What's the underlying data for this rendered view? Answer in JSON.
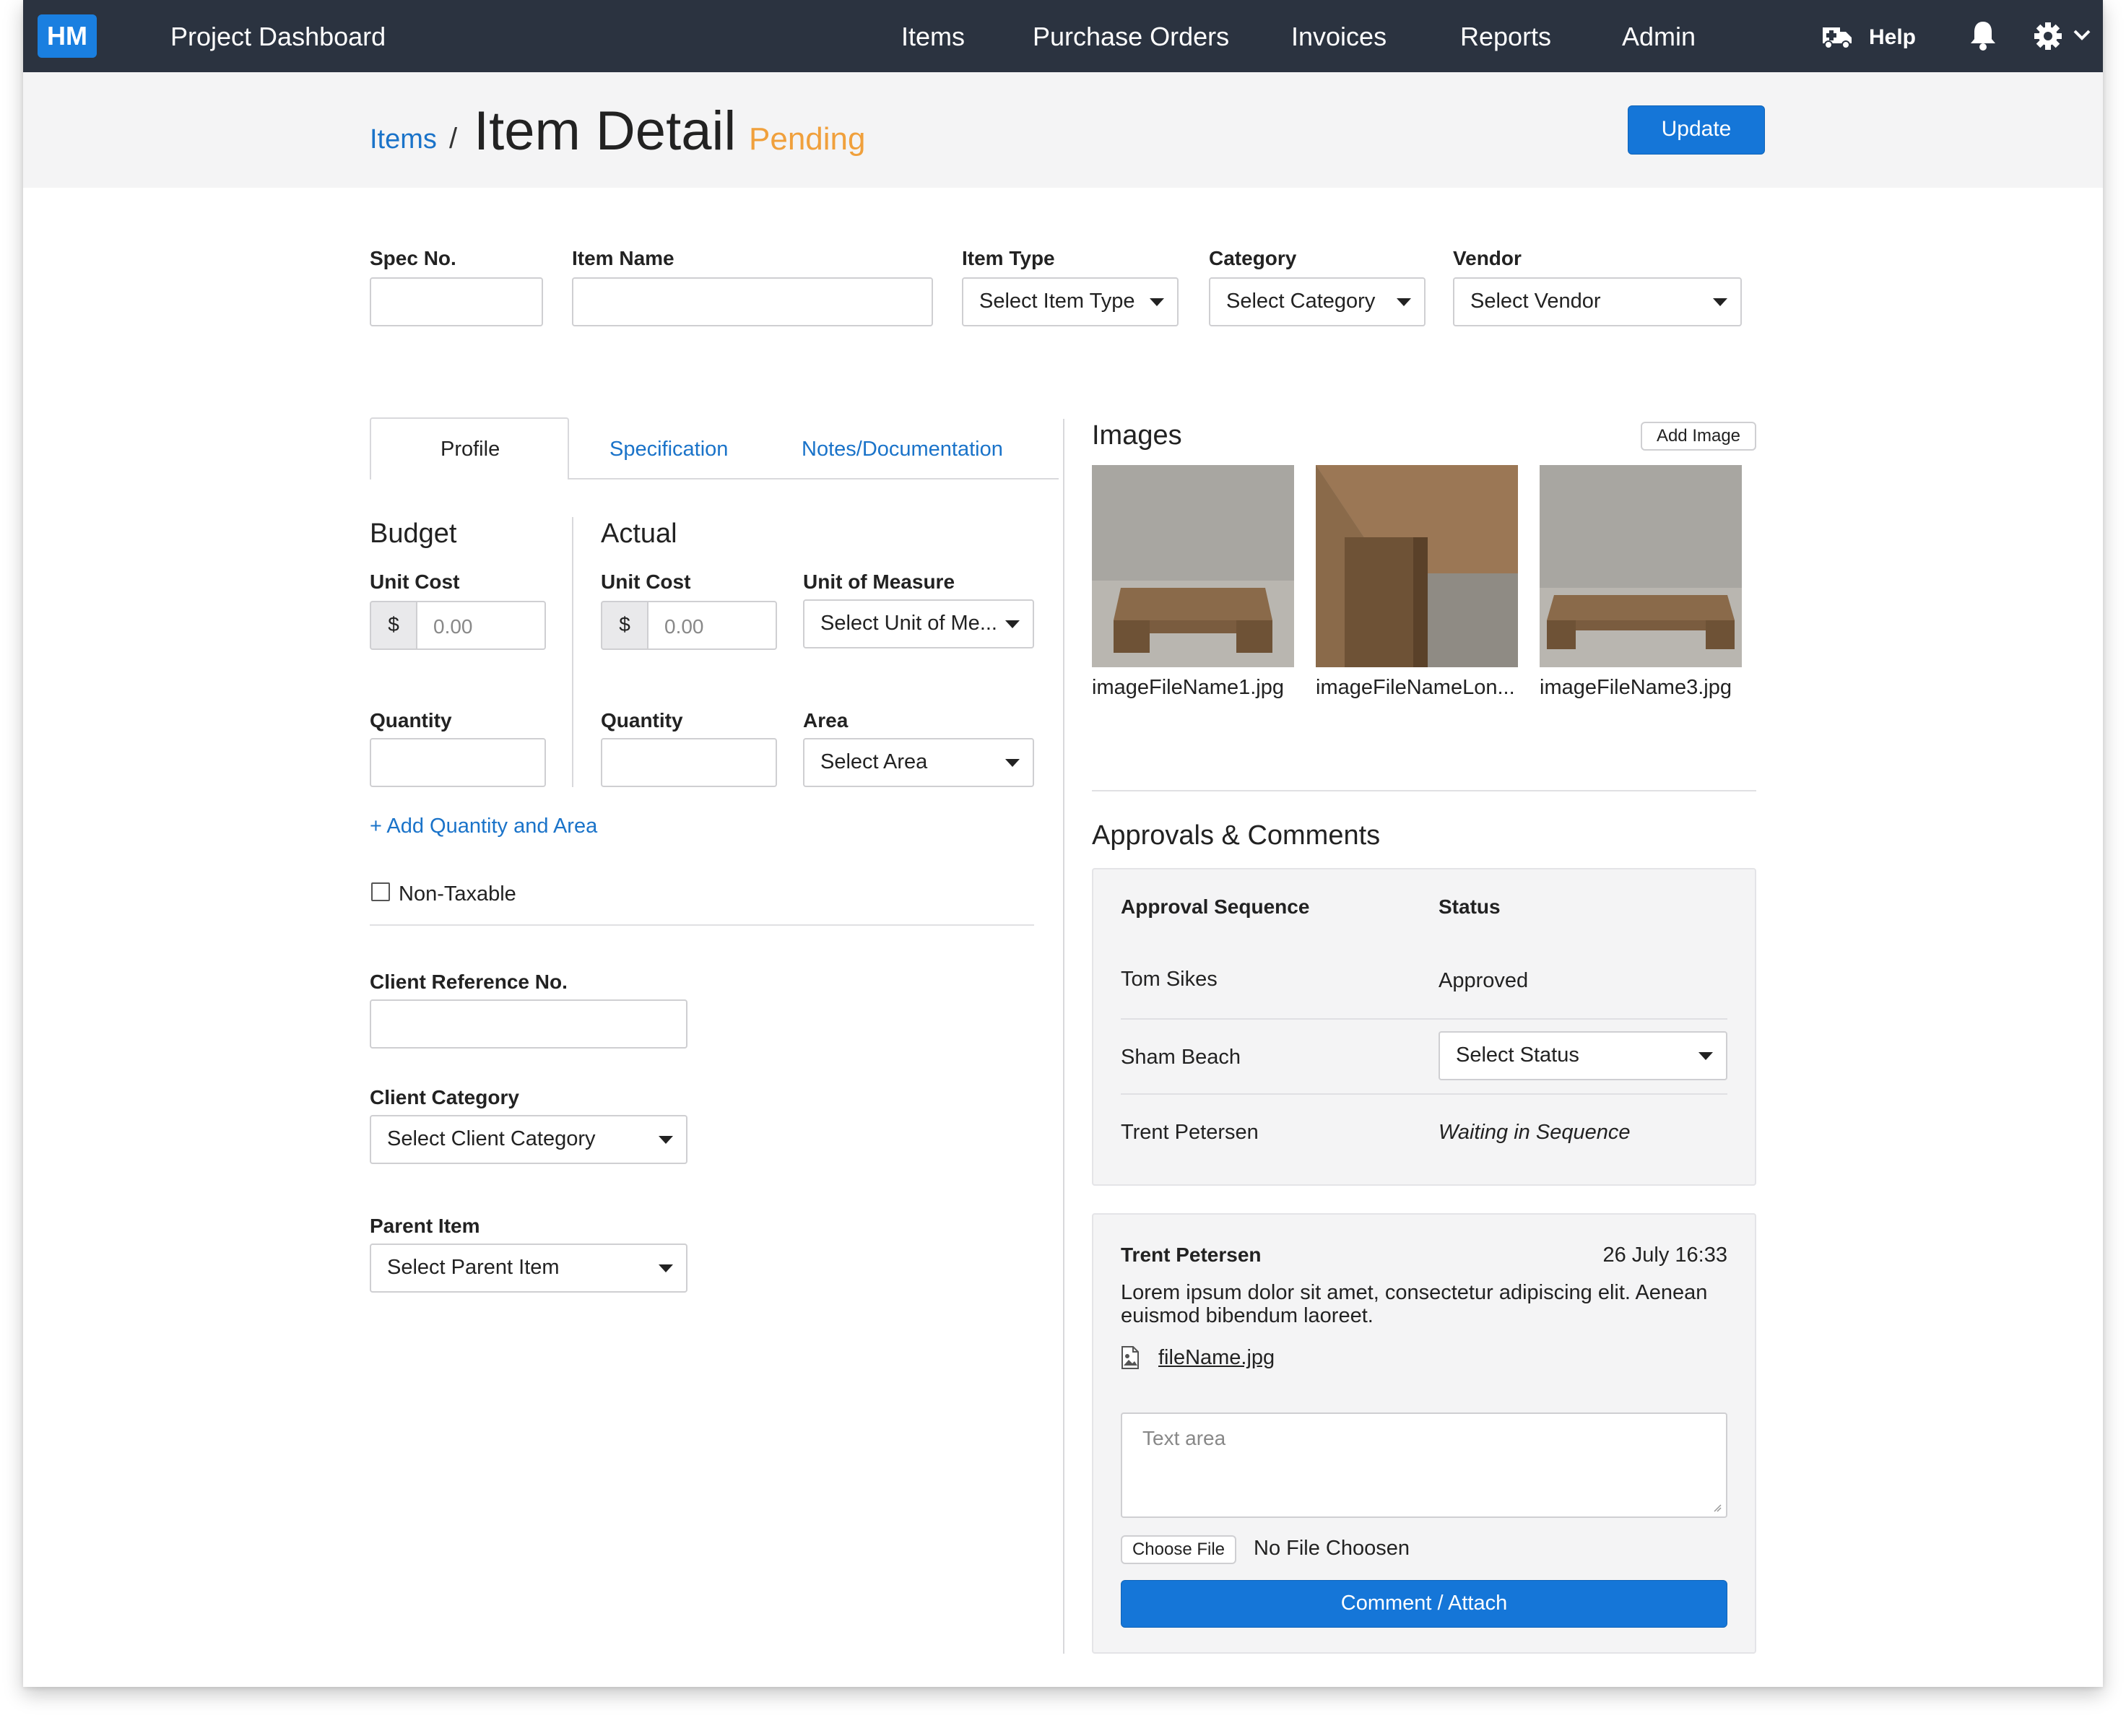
{
  "nav": {
    "logo": "HM",
    "app_title": "Project Dashboard",
    "links": [
      "Items",
      "Purchase Orders",
      "Invoices",
      "Reports",
      "Admin"
    ],
    "help": "Help"
  },
  "header": {
    "breadcrumb_parent": "Items",
    "breadcrumb_sep": "/",
    "title": "Item Detail",
    "status": "Pending",
    "update_button": "Update"
  },
  "top_fields": {
    "spec_no": {
      "label": "Spec No.",
      "value": ""
    },
    "item_name": {
      "label": "Item Name",
      "value": ""
    },
    "item_type": {
      "label": "Item Type",
      "value": "Select Item Type"
    },
    "category": {
      "label": "Category",
      "value": "Select Category"
    },
    "vendor": {
      "label": "Vendor",
      "value": "Select Vendor"
    }
  },
  "tabs": [
    "Profile",
    "Specification",
    "Notes/Documentation"
  ],
  "profile": {
    "budget_heading": "Budget",
    "actual_heading": "Actual",
    "unit_cost_label": "Unit Cost",
    "currency_prefix": "$",
    "cost_placeholder": "0.00",
    "unit_of_measure_label": "Unit of Measure",
    "unit_of_measure_value": "Select Unit of Me...",
    "quantity_label": "Quantity",
    "area_label": "Area",
    "area_value": "Select Area",
    "add_quantity_link": "+ Add Quantity and Area",
    "non_taxable_label": "Non-Taxable",
    "client_ref_label": "Client Reference No.",
    "client_category_label": "Client Category",
    "client_category_value": "Select Client Category",
    "parent_item_label": "Parent Item",
    "parent_item_value": "Select Parent Item"
  },
  "images": {
    "heading": "Images",
    "add_button": "Add Image",
    "files": [
      "imageFileName1.jpg",
      "imageFileNameLon...",
      "imageFileName3.jpg"
    ]
  },
  "approvals": {
    "heading": "Approvals & Comments",
    "col_sequence": "Approval Sequence",
    "col_status": "Status",
    "rows": [
      {
        "name": "Tom Sikes",
        "status": "Approved"
      },
      {
        "name": "Sham Beach",
        "status": "Select Status"
      },
      {
        "name": "Trent Petersen",
        "status": "Waiting in Sequence"
      }
    ]
  },
  "comment": {
    "author": "Trent Petersen",
    "date": "26 July 16:33",
    "body": "Lorem ipsum dolor sit amet, consectetur adipiscing elit. Aenean euismod bibendum laoreet.",
    "attachment": "fileName.jpg",
    "textarea_placeholder": "Text area",
    "choose_file": "Choose File",
    "no_file": "No File Choosen",
    "submit": "Comment / Attach"
  },
  "colors": {
    "nav_bg": "#2b3340",
    "accent": "#1576d8",
    "pending": "#f0a03c",
    "link": "#1a73c9"
  },
  "icons": [
    "ambulance-icon",
    "bell-icon",
    "gear-icon",
    "chevron-down-icon",
    "image-file-icon"
  ]
}
